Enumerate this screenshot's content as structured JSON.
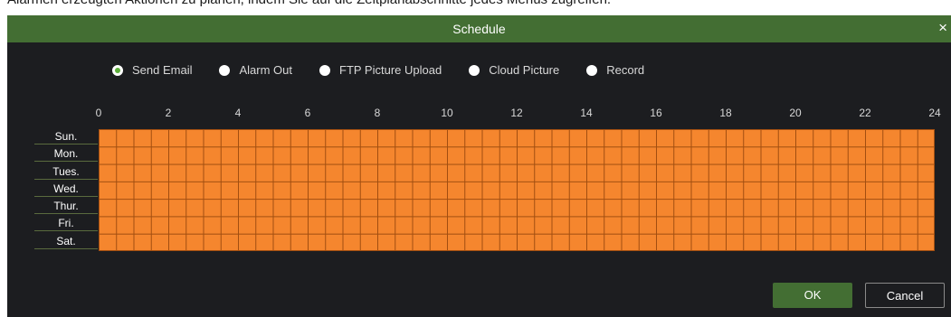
{
  "instruction_text": "Alarmen erzeugten Aktionen zu planen, indem Sie auf die Zeitplanabschnitte jedes Menüs zugreifen.",
  "dialog": {
    "title": "Schedule",
    "close_symbol": "×"
  },
  "actions": [
    {
      "label": "Send Email",
      "checked": true
    },
    {
      "label": "Alarm Out",
      "checked": false
    },
    {
      "label": "FTP Picture Upload",
      "checked": false
    },
    {
      "label": "Cloud Picture",
      "checked": false
    },
    {
      "label": "Record",
      "checked": false
    }
  ],
  "hour_ticks": [
    "0",
    "2",
    "4",
    "6",
    "8",
    "10",
    "12",
    "14",
    "16",
    "18",
    "20",
    "22",
    "24"
  ],
  "days": [
    "Sun.",
    "Mon.",
    "Tues.",
    "Wed.",
    "Thur.",
    "Fri.",
    "Sat."
  ],
  "schedule": {
    "all_selected": true,
    "selected_color": "#f5862e",
    "grid_line_color": "#a14e10",
    "slots_per_day": 48
  },
  "buttons": {
    "ok_label": "OK",
    "cancel_label": "Cancel"
  },
  "colors": {
    "accent": "#436e33",
    "radio_checked": "#5cae3a",
    "background": "#1c1d20"
  }
}
